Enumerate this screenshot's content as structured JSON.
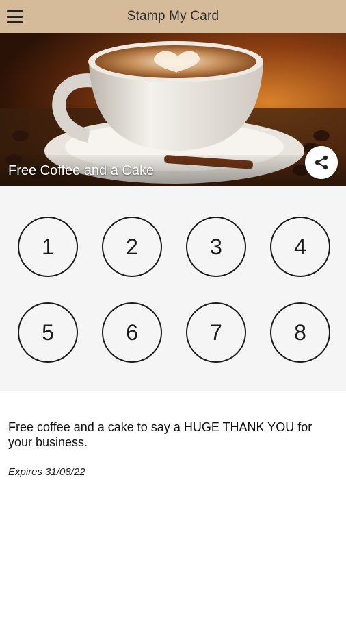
{
  "appbar": {
    "title": "Stamp My Card",
    "menu_icon": "hamburger-menu-icon",
    "background": "#d5bb99"
  },
  "hero": {
    "title": "Free Coffee and a Cake",
    "share_icon": "share-icon"
  },
  "stamps": {
    "labels": [
      "1",
      "2",
      "3",
      "4",
      "5",
      "6",
      "7",
      "8"
    ]
  },
  "details": {
    "description": "Free coffee and a cake to say a HUGE THANK YOU for your business.",
    "expiry": "Expires 31/08/22"
  }
}
